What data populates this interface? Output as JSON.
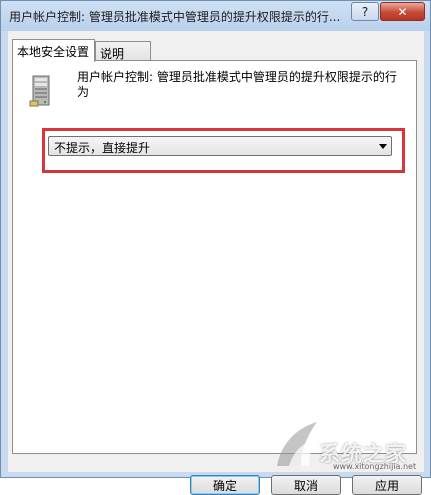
{
  "window": {
    "title": "用户帐户控制: 管理员批准模式中管理员的提升权限提示的行...",
    "help_label": "?",
    "close_label": "✕"
  },
  "tabs": [
    {
      "label": "本地安全设置",
      "active": true
    },
    {
      "label": "说明",
      "active": false
    }
  ],
  "policy": {
    "icon": "server-icon",
    "title": "用户帐户控制: 管理员批准模式中管理员的提升权限提示的行为"
  },
  "setting": {
    "selected_value": "不提示，直接提升",
    "highlight_color": "#d9343c"
  },
  "buttons": {
    "ok": "确定",
    "cancel": "取消",
    "apply": "应用"
  },
  "watermark": {
    "text": "系统之家",
    "url": "www.xitongzhijia.net"
  }
}
